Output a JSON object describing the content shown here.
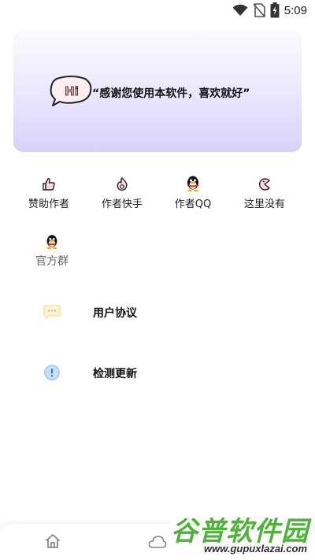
{
  "status_bar": {
    "time": "5:09",
    "icons": [
      "wifi-icon",
      "no-sim-icon",
      "battery-charging-icon"
    ]
  },
  "banner": {
    "badge_text": "Hi",
    "quote": "“感谢您使用本软件，喜欢就好”"
  },
  "grid": [
    {
      "label": "赞助作者",
      "icon": "thumbs-up-icon"
    },
    {
      "label": "作者快手",
      "icon": "kuaishou-icon"
    },
    {
      "label": "作者QQ",
      "icon": "qq-penguin-icon"
    },
    {
      "label": "这里没有",
      "icon": "pacman-icon"
    },
    {
      "label": "官方群",
      "icon": "qq-penguin-icon"
    }
  ],
  "list": [
    {
      "label": "用户协议",
      "icon": "chat-bubble-icon"
    },
    {
      "label": "检测更新",
      "icon": "info-circle-icon"
    }
  ],
  "bottom_nav": {
    "items": [
      "home-icon",
      "cloud-icon"
    ]
  },
  "watermark": {
    "title": "谷普软件园",
    "url": "www.gupuxlazai.com"
  },
  "colors": {
    "banner_gradient_start": "#fbfaff",
    "banner_gradient_end": "#d8d2fb",
    "watermark_green": "#4fb23a"
  }
}
